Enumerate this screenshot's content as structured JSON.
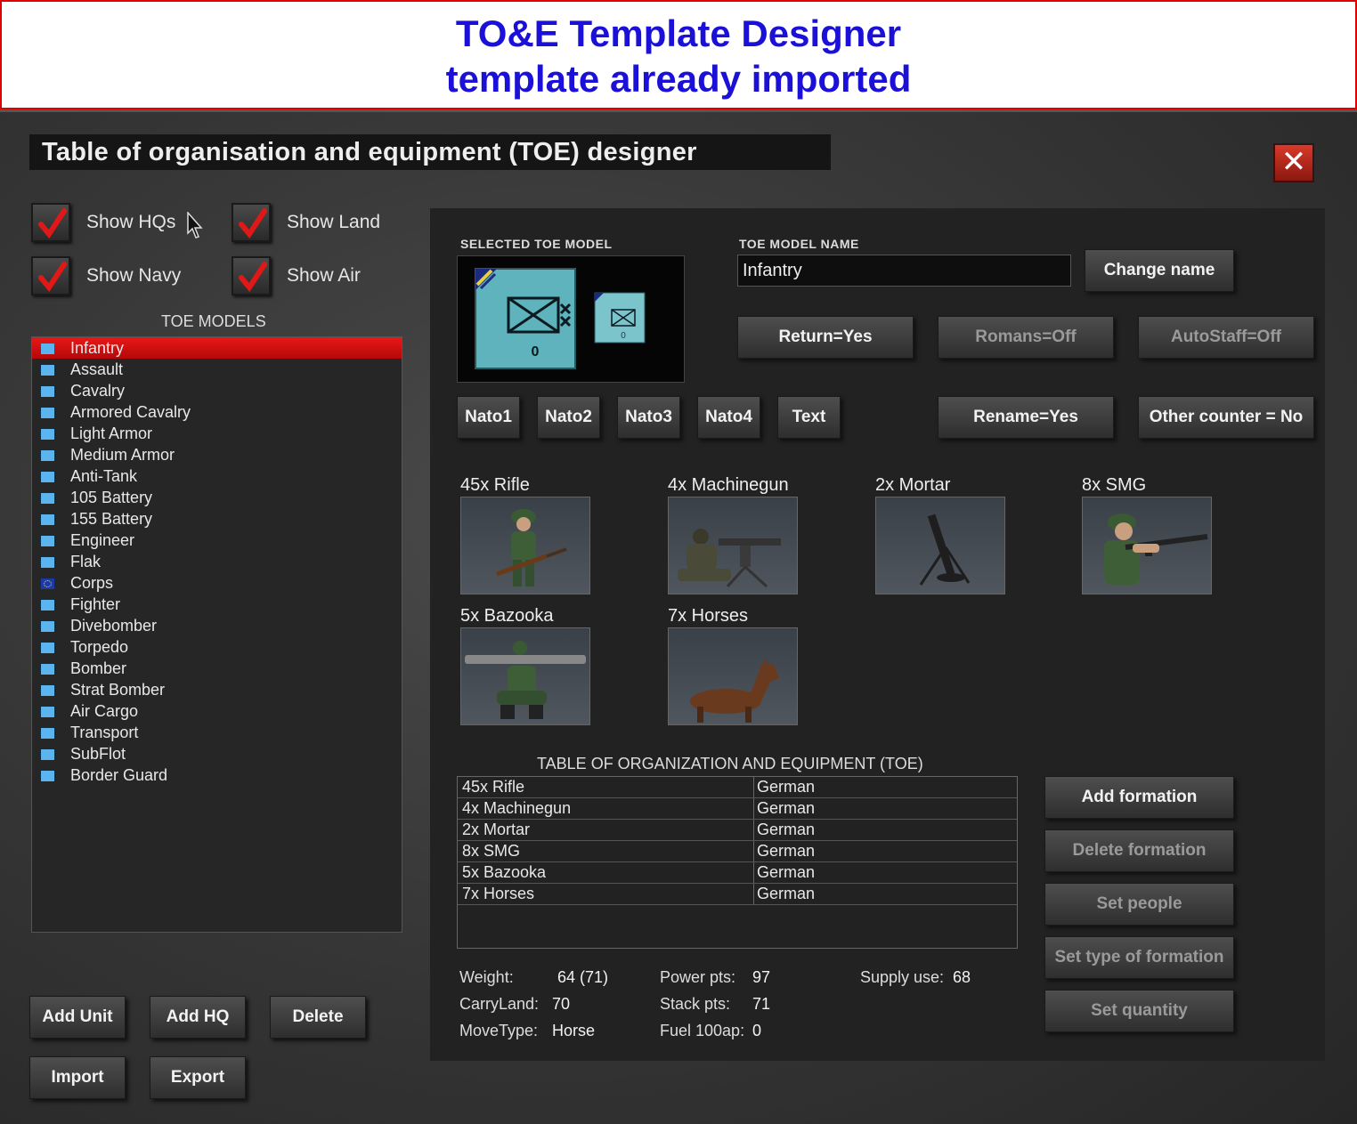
{
  "banner": {
    "line1": "TO&E Template Designer",
    "line2": "template already imported"
  },
  "window": {
    "title": "Table of organisation and equipment (TOE) designer",
    "close_label": "✕"
  },
  "filters": [
    {
      "label": "Show HQs",
      "checked": true
    },
    {
      "label": "Show Land",
      "checked": true
    },
    {
      "label": "Show Navy",
      "checked": true
    },
    {
      "label": "Show Air",
      "checked": true
    }
  ],
  "models": {
    "heading": "TOE MODELS",
    "items": [
      "Infantry",
      "Assault",
      "Cavalry",
      "Armored Cavalry",
      "Light Armor",
      "Medium Armor",
      "Anti-Tank",
      "105 Battery",
      "155 Battery",
      "Engineer",
      "Flak",
      "Corps",
      "Fighter",
      "Divebomber",
      "Torpedo",
      "Bomber",
      "Strat Bomber",
      "Air Cargo",
      "Transport",
      "SubFlot",
      "Border Guard"
    ],
    "selected": "Infantry"
  },
  "left_buttons": {
    "add_unit": "Add Unit",
    "add_hq": "Add HQ",
    "delete": "Delete",
    "import": "Import",
    "export": "Export"
  },
  "selected_model": {
    "caption": "SELECTED TOE MODEL",
    "counter_value": "0",
    "small_counter_value": "0"
  },
  "model_name": {
    "caption": "TOE MODEL NAME",
    "value": "Infantry",
    "change_label": "Change name"
  },
  "toggles": {
    "return": "Return=Yes",
    "romans": "Romans=Off",
    "autostaff": "AutoStaff=Off",
    "rename": "Rename=Yes",
    "other_counter": "Other counter = No"
  },
  "nato_buttons": [
    "Nato1",
    "Nato2",
    "Nato3",
    "Nato4",
    "Text"
  ],
  "equipment": [
    {
      "label": "45x Rifle",
      "icon": "rifle-soldier-icon"
    },
    {
      "label": "4x Machinegun",
      "icon": "machinegun-crew-icon"
    },
    {
      "label": "2x Mortar",
      "icon": "mortar-icon"
    },
    {
      "label": "8x SMG",
      "icon": "smg-soldier-icon"
    },
    {
      "label": "5x Bazooka",
      "icon": "bazooka-soldier-icon"
    },
    {
      "label": "7x Horses",
      "icon": "horse-icon"
    }
  ],
  "toe_table": {
    "heading": "TABLE OF ORGANIZATION AND EQUIPMENT (TOE)",
    "rows": [
      [
        "45x Rifle",
        "German"
      ],
      [
        "4x Machinegun",
        "German"
      ],
      [
        "2x Mortar",
        "German"
      ],
      [
        "8x SMG",
        "German"
      ],
      [
        "5x Bazooka",
        "German"
      ],
      [
        "7x Horses",
        "German"
      ]
    ]
  },
  "formation_buttons": {
    "add": "Add formation",
    "delete": "Delete formation",
    "set_people": "Set people",
    "set_type": "Set type of formation",
    "set_quantity": "Set quantity"
  },
  "stats": {
    "weight_label": "Weight:",
    "weight": "64 (71)",
    "carryland_label": "CarryLand:",
    "carryland": "70",
    "movetype_label": "MoveType:",
    "movetype": "Horse",
    "power_label": "Power pts:",
    "power": "97",
    "stack_label": "Stack pts:",
    "stack": "71",
    "fuel_label": "Fuel 100ap:",
    "fuel": "0",
    "supply_label": "Supply use:",
    "supply": "68"
  },
  "colors": {
    "banner_text": "#1a10d8",
    "banner_border": "#e00000",
    "selected_row": "#d01010",
    "counter": "#5fb3bd"
  }
}
